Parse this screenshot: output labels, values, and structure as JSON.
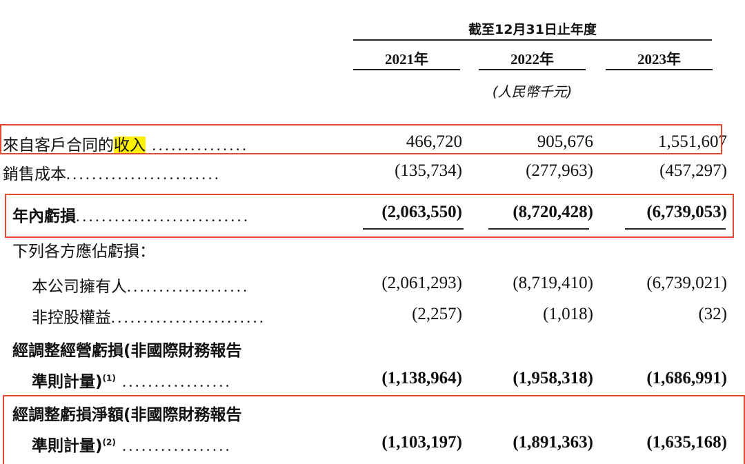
{
  "header": {
    "period": "截至12月31日止年度",
    "years": [
      "2021年",
      "2022年",
      "2023年"
    ],
    "unit": "(人民幣千元)"
  },
  "rows": [
    {
      "label_pre": "來自客戶合同的",
      "label_hl": "收入",
      "dots": " ...............",
      "values": [
        "466,720",
        "905,676",
        "1,551,607"
      ]
    },
    {
      "label": "銷售成本",
      "dots": "........................",
      "values": [
        "(135,734)",
        "(277,963)",
        "(457,297)"
      ]
    },
    {
      "label": "年內虧損",
      "dots": "...........................",
      "values": [
        "(2,063,550)",
        "(8,720,428)",
        "(6,739,053)"
      ]
    },
    {
      "label": "下列各方應佔虧損："
    },
    {
      "label": "本公司擁有人",
      "dots": "...................",
      "values": [
        "(2,061,293)",
        "(8,719,410)",
        "(6,739,021)"
      ]
    },
    {
      "label": "非控股權益",
      "dots": "........................",
      "values": [
        "(2,257)",
        "(1,018)",
        "(32)"
      ]
    },
    {
      "label": "經調整經營虧損(非國際財務報告"
    },
    {
      "label": "準則計量)",
      "note": "(1)",
      "dots": " .................",
      "values": [
        "(1,138,964)",
        "(1,958,318)",
        "(1,686,991)"
      ]
    },
    {
      "label": "經調整虧損淨額(非國際財務報告"
    },
    {
      "label": "準則計量)",
      "note": "(2)",
      "dots": " .................",
      "values": [
        "(1,103,197)",
        "(1,891,363)",
        "(1,635,168)"
      ]
    }
  ],
  "colors": {
    "highlight": "#fff200",
    "box": "#e2492e"
  }
}
